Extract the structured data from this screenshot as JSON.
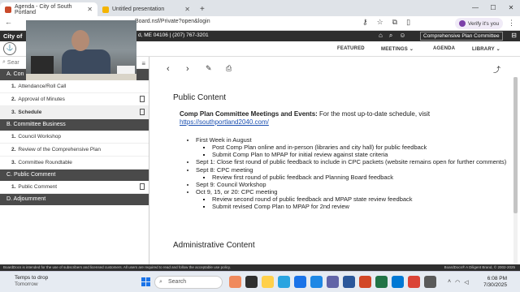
{
  "browser": {
    "tabs": [
      {
        "title": "Agenda - City of South Portland",
        "active": true
      },
      {
        "title": "Untitled presentation",
        "active": false
      }
    ],
    "new_tab": "+",
    "url": "Board.nsf/Private?open&login",
    "verify": "Verify it's you"
  },
  "site": {
    "name": "City of",
    "address": "d, ME 04106 | (207) 767-3201",
    "committee_button": "Comprehensive Plan Committee"
  },
  "nav": {
    "featured": "FEATURED",
    "meetings": "MEETINGS",
    "agenda": "AGENDA",
    "library": "LIBRARY"
  },
  "sidebar": {
    "search_placeholder": "Sear",
    "sections": [
      {
        "label": "A. Con",
        "items": [
          {
            "num": "1.",
            "label": "Attendance/Roll Call",
            "has_doc": false,
            "selected": false
          },
          {
            "num": "2.",
            "label": "Approval of Minutes",
            "has_doc": true,
            "selected": false
          },
          {
            "num": "3.",
            "label": "Schedule",
            "has_doc": true,
            "selected": true
          }
        ]
      },
      {
        "label": "B. Committee Business",
        "items": [
          {
            "num": "1.",
            "label": "Council Workshop",
            "has_doc": false,
            "selected": false
          },
          {
            "num": "2.",
            "label": "Review of the Comprehensive Plan",
            "has_doc": false,
            "selected": false
          },
          {
            "num": "3.",
            "label": "Committee Roundtable",
            "has_doc": false,
            "selected": false
          }
        ]
      },
      {
        "label": "C. Public Comment",
        "items": [
          {
            "num": "1.",
            "label": "Public Comment",
            "has_doc": true,
            "selected": false
          }
        ]
      },
      {
        "label": "D. Adjournment",
        "items": []
      }
    ]
  },
  "content": {
    "heading": "Public Content",
    "lead_bold": "Comp Plan Committee Meetings and Events:",
    "lead_text": " For the most up-to-date schedule, visit ",
    "link": "https://southportland2040.com/",
    "bullets": [
      {
        "text": "First Week in August",
        "sub": [
          "Post Comp Plan online and in-person (libraries and city hall) for public feedback",
          "Submit Comp Plan to MPAP for initial review against state criteria"
        ]
      },
      {
        "text": "Sept 1: Close first round of public feedback to include in CPC packets (website remains open for further comments)",
        "sub": []
      },
      {
        "text": "Sept 8: CPC meeting",
        "sub": [
          "Review first round of public feedback and Planning Board feedback"
        ]
      },
      {
        "text": "Sept 9: Council Workshop",
        "sub": []
      },
      {
        "text": "Oct 9, 15, or 20: CPC meeting",
        "sub": [
          "Review second round of public feedback and MPAP state review feedback",
          "Submit revised Comp Plan to MPAP for 2nd review"
        ]
      }
    ],
    "admin_heading": "Administrative Content"
  },
  "footer": {
    "left": "BoardDocs is intended for the use of subscribers and licensed customers. All users are required to read and follow the acceptable use policy.",
    "right": "BoardDocs® A Diligent Brand, © 2002-2025"
  },
  "taskbar": {
    "weather_line1": "Temps to drop",
    "weather_line2": "Tomorrow",
    "search": "Search",
    "time": "6:08 PM",
    "date": "7/30/2025"
  },
  "colors": {
    "section_bg": "#4a4a4a",
    "header_bg": "#2e2e2e",
    "link": "#1a4fb0"
  }
}
